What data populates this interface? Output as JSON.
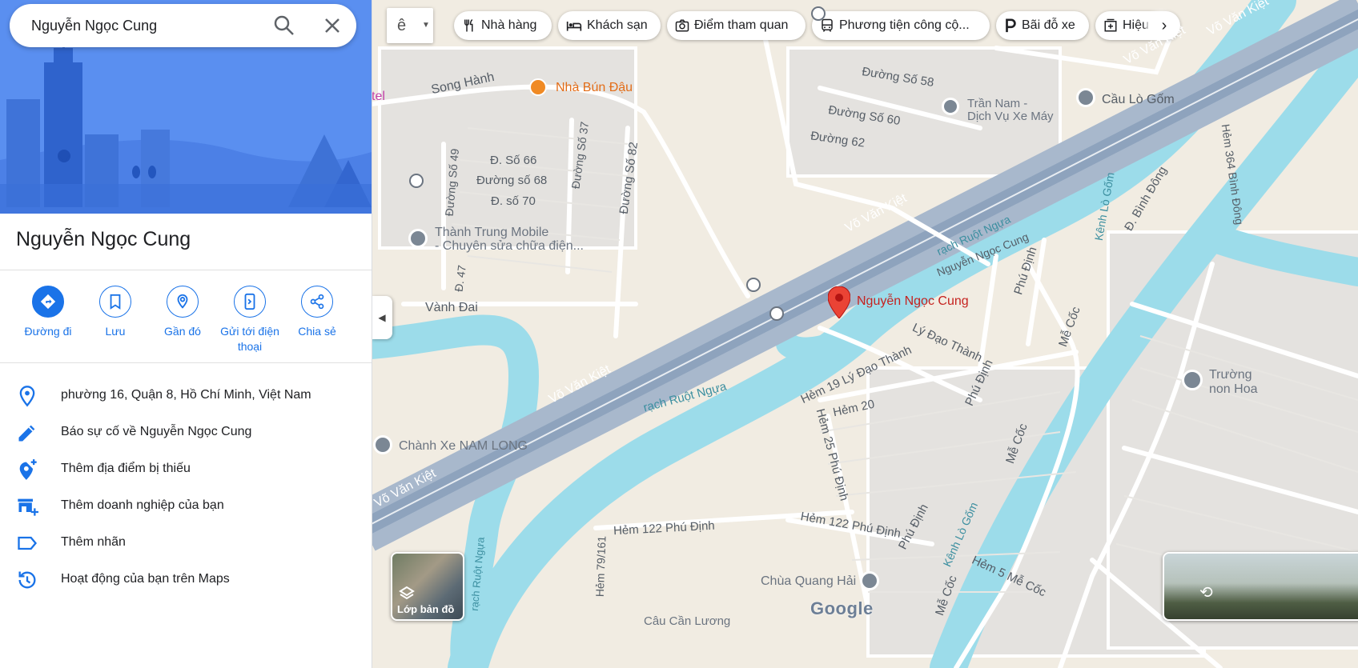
{
  "search": {
    "query": "Nguyễn Ngọc Cung"
  },
  "place": {
    "title": "Nguyễn Ngọc Cung"
  },
  "actions": [
    {
      "label": "Đường đi",
      "icon": "directions-icon"
    },
    {
      "label": "Lưu",
      "icon": "bookmark-icon"
    },
    {
      "label": "Gần đó",
      "icon": "nearby-icon"
    },
    {
      "label": "Gửi tới điện thoại",
      "icon": "send-to-phone-icon"
    },
    {
      "label": "Chia sẻ",
      "icon": "share-icon"
    }
  ],
  "info_rows": [
    {
      "text": "phường 16, Quận 8, Hồ Chí Minh, Việt Nam",
      "icon": "location-pin-icon"
    },
    {
      "text": "Báo sự cố về Nguyễn Ngọc Cung",
      "icon": "pencil-icon"
    },
    {
      "text": "Thêm địa điểm bị thiếu",
      "icon": "add-place-icon"
    },
    {
      "text": "Thêm doanh nghiệp của bạn",
      "icon": "add-business-icon"
    },
    {
      "text": "Thêm nhãn",
      "icon": "label-icon"
    },
    {
      "text": "Hoạt động của bạn trên Maps",
      "icon": "history-icon"
    }
  ],
  "chips": [
    {
      "label": "Nhà hàng",
      "icon": "restaurant-icon"
    },
    {
      "label": "Khách sạn",
      "icon": "hotel-icon"
    },
    {
      "label": "Điểm tham quan",
      "icon": "camera-icon"
    },
    {
      "label": "Phương tiện công cộ...",
      "icon": "transit-icon"
    },
    {
      "label": "Bãi đỗ xe",
      "icon": "parking-icon"
    },
    {
      "label": "Hiệu",
      "icon": "pharmacy-icon"
    }
  ],
  "map_labels": {
    "selected_pin": "Nguyễn Ngọc Cung",
    "song_hanh": "Song Hành",
    "nha_bun_dau": "Nhà Bún Đậu",
    "otel": "tel",
    "duong_so_58": "Đường Số 58",
    "duong_so_60": "Đường Số 60",
    "duong_62": "Đường 62",
    "tran_nam_1": "Trần Nam -",
    "tran_nam_2": "Dịch Vụ Xe Máy",
    "cau_lo_gom": "Cầu Lò Gốm",
    "hem_364": "Hẻm 364 Bình Đông",
    "d_binh_dong": "Đ. Bình Đông",
    "kenh_lo_gom_top": "Kênh Lò Gốm",
    "d_so_66": "Đ. Số 66",
    "duong_so_68": "Đường số 68",
    "d_so_70": "Đ. số 70",
    "duong_so_49": "Đường Số 49",
    "duong_so_37": "Đường Số 37",
    "duong_so_82": "Đường Số 82",
    "thanh_trung_1": "Thành Trung Mobile",
    "thanh_trung_2": "- Chuyên sửa chữa điện...",
    "d_47": "Đ. 47",
    "vanh_dai": "Vành Đai",
    "vo_van_kiet_1": "Võ Văn Kiệt",
    "vo_van_kiet_2": "Võ Văn Kiệt",
    "vo_van_kiet_3": "Võ Văn Kiệt",
    "vo_van_kiet_4": "Võ Văn Kiệt",
    "vo_van_kiet_5": "Võ Văn Kiệt",
    "rach_ruot_ngua_1": "rạch Ruột Ngựa",
    "rach_ruot_ngua_2": "rạch Ruột Ngựa",
    "nguyen_ngoc_cung_road": "Nguyễn Ngọc Cung",
    "phu_dinh_1": "Phú Định",
    "phu_dinh_2": "Phú Định",
    "phu_dinh_3": "Phú Định",
    "me_coc_1": "Mễ Cốc",
    "me_coc_2": "Mễ Cốc",
    "me_coc_3": "Mễ Cốc",
    "ly_dao_thanh": "Lý Đạo Thành",
    "hem_19": "Hẻm 19 Lý Đạo Thành",
    "hem_20": "Hẻm 20",
    "hem_25": "Hẻm 25 Phú Định",
    "chanh_xe": "Chành Xe NAM LONG",
    "truong_1": "Trường",
    "truong_2": "non Hoa",
    "kenh_lo_gom_bottom": "Kênh Lò Gốm",
    "hem_122_a": "Hẻm 122 Phú Định",
    "hem_122_b": "Hẻm 122 Phú Định",
    "hem_79": "Hẻm 79/161",
    "chua_quang_hai": "Chùa Quang Hải",
    "hem_5_me_coc": "Hẻm 5 Mễ Cốc",
    "rach_ruot_ngua_3": "rạch Ruột Ngựa",
    "bottom_partial": "Câu Cần Lương",
    "google_logo": "Google",
    "layers_label": "Lớp bản đồ",
    "input_tool": "ê"
  }
}
